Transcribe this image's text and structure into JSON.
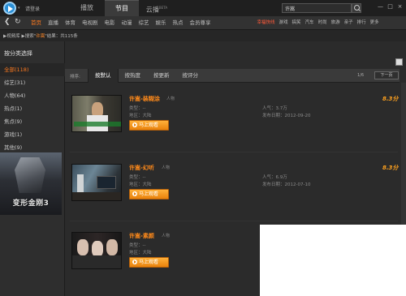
{
  "topbar": {
    "login": "请登录",
    "tabs": [
      {
        "label": "播放",
        "sup": ""
      },
      {
        "label": "节目",
        "sup": ""
      },
      {
        "label": "云播",
        "sup": "BETA"
      }
    ],
    "search_value": "许嵩",
    "window_buttons": [
      "—",
      "□",
      "×"
    ]
  },
  "nav": {
    "back_icon": "back-arrow-icon",
    "refresh_icon": "refresh-icon",
    "categories": [
      "首页",
      "直播",
      "体育",
      "电视剧",
      "电影",
      "动漫",
      "综艺",
      "娱乐",
      "热点",
      "会员尊享"
    ],
    "subcategories": [
      "幸福快线",
      "游戏",
      "搞笑",
      "汽车",
      "时尚",
      "旅游",
      "亲子",
      "排行",
      "更多"
    ]
  },
  "breadcrumb": {
    "prefix": "▶视频库",
    "sep": "▶搜索\"",
    "keyword": "许嵩",
    "suffix": "\"结果：共115条"
  },
  "sidebar": {
    "title": "按分类选择",
    "items": [
      "全部(118)",
      "综艺(31)",
      "人物(64)",
      "热点(1)",
      "焦点(9)",
      "游戏(1)",
      "其他(9)"
    ],
    "poster_title": "变形金刚3"
  },
  "filter": {
    "label": "排序:",
    "tabs": [
      "按默认",
      "按热度",
      "按更新",
      "按评分"
    ],
    "page": "1/6",
    "next": "下一页"
  },
  "results": [
    {
      "title": "许嵩-装糊涂",
      "tag": "人物",
      "type": "类型：--",
      "region": "地区：大陆",
      "popularity": "人气：3.7万",
      "date": "发布日期：2012-09-20",
      "score": "8.3分",
      "play": "马上观看"
    },
    {
      "title": "许嵩-幻听",
      "tag": "人物",
      "type": "类型：--",
      "region": "地区：大陆",
      "popularity": "人气：6.9万",
      "date": "发布日期：2012-07-10",
      "score": "8.3分",
      "play": "马上观看"
    },
    {
      "title": "许嵩-素颜",
      "tag": "人物",
      "type": "类型：--",
      "region": "地区：大陆",
      "popularity": "",
      "date": "",
      "score": "",
      "play": "马上观看"
    }
  ],
  "colors": {
    "accent": "#ff7a1f",
    "background": "#2b2b2b",
    "play_button": "#f59a20"
  }
}
